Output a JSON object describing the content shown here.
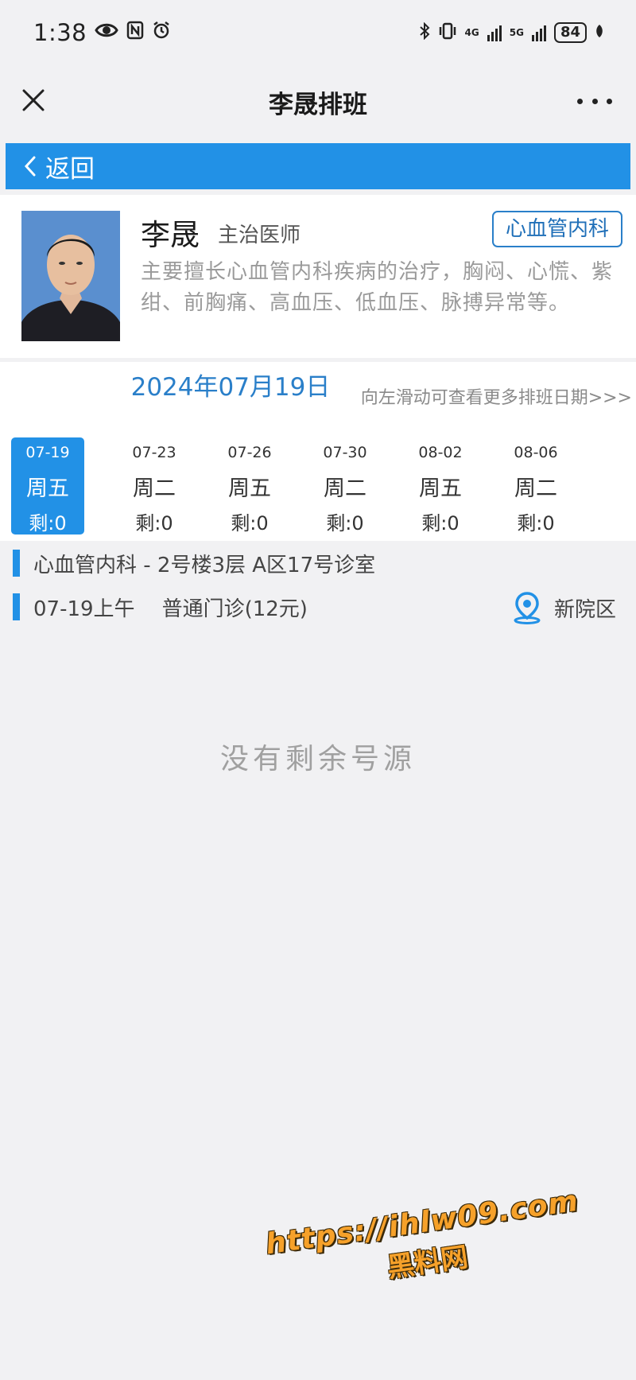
{
  "status_bar": {
    "time": "1:38",
    "battery": "84",
    "network_1": "4G",
    "network_2": "5G"
  },
  "title_bar": {
    "title": "李晟排班"
  },
  "back_bar": {
    "label": "返回",
    "color": "#2291e6"
  },
  "doctor": {
    "name": "李晟",
    "title": "主治医师",
    "department": "心血管内科",
    "description": "主要擅长心血管内科疾病的治疗，胸闷、心慌、紫绀、前胸痛、高血压、低血压、脉搏异常等。"
  },
  "schedule": {
    "current_date": "2024年07月19日",
    "swipe_hint": "向左滑动可查看更多排班日期>>>",
    "dates": [
      {
        "date": "07-19",
        "weekday": "周五",
        "remain": "剩:0",
        "active": true
      },
      {
        "date": "07-23",
        "weekday": "周二",
        "remain": "剩:0",
        "active": false
      },
      {
        "date": "07-26",
        "weekday": "周五",
        "remain": "剩:0",
        "active": false
      },
      {
        "date": "07-30",
        "weekday": "周二",
        "remain": "剩:0",
        "active": false
      },
      {
        "date": "08-02",
        "weekday": "周五",
        "remain": "剩:0",
        "active": false
      },
      {
        "date": "08-06",
        "weekday": "周二",
        "remain": "剩:0",
        "active": false
      }
    ]
  },
  "info": {
    "location": "心血管内科 - 2号楼3层 A区17号诊室",
    "session_time": "07-19上午",
    "session_type": "普通门诊(12元)",
    "campus": "新院区"
  },
  "empty_message": "没有剩余号源",
  "watermark": {
    "line1": "https://ihlw09.com",
    "line2": "黑料网"
  }
}
